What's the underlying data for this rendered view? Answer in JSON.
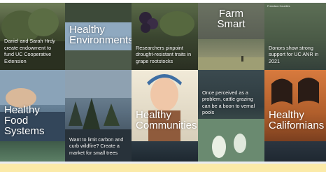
{
  "tiles": {
    "hrdy_caption": "Daniel and Sarah Hrdy create endowment to fund UC Cooperative Extension",
    "healthy_environments": "Healthy Environments",
    "grape_caption": "Researchers pinpoint drought-resistant traits in grape rootstocks",
    "farm_smart": "Farm Smart",
    "donors_small_header": "Francisco Counties",
    "donors_caption": "Donors show strong support for UC ANR in 2021",
    "healthy_food_systems": "Healthy Food Systems",
    "carbon_caption": "Want to limit carbon and curb wildfire? Create a market for small trees",
    "healthy_communities": "Healthy Communities",
    "cattle_caption": "Once perceived as a problem, cattle grazing can be a boon to vernal pools",
    "healthy_californians": "Healthy Californians"
  },
  "colors": {
    "bottom_band": "#fbeaa8",
    "text": "#ffffff"
  }
}
